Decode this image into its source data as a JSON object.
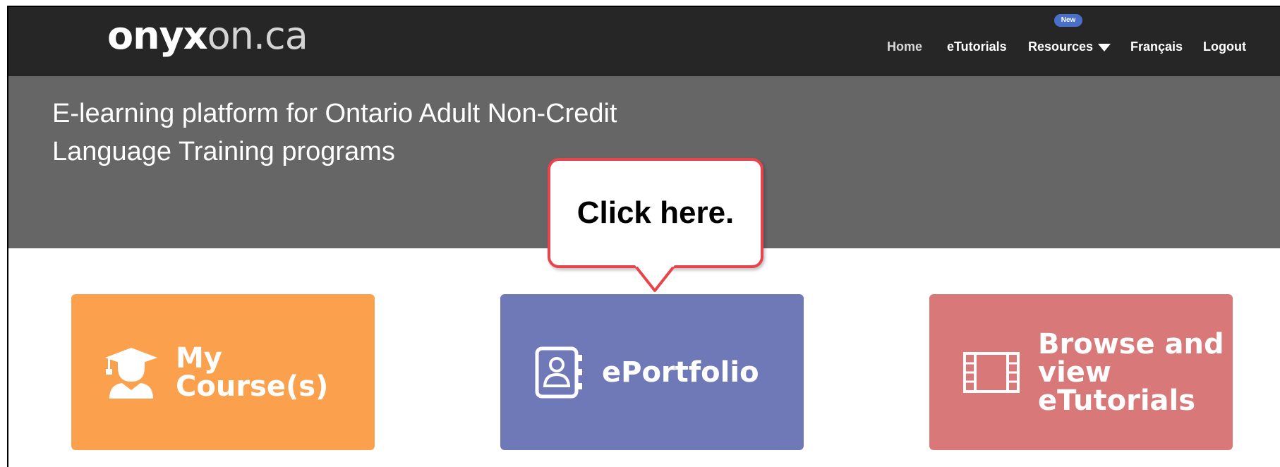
{
  "header": {
    "logo_bold": "onyx",
    "logo_light": "on.ca",
    "nav": {
      "home": "Home",
      "etutorials": "eTutorials",
      "resources": "Resources",
      "resources_badge": "New",
      "francais": "Français",
      "logout": "Logout"
    }
  },
  "hero": {
    "title": "E-learning platform for Ontario Adult Non-Credit Language Training programs"
  },
  "tiles": {
    "courses": {
      "label": "My Course(s)",
      "icon": "graduate-icon",
      "color": "#fba14d"
    },
    "portfolio": {
      "label": "ePortfolio",
      "icon": "contact-book-icon",
      "color": "#7079b8"
    },
    "tutorials": {
      "label": "Browse and\nview eTutorials",
      "icon": "film-strip-icon",
      "color": "#d97879"
    }
  },
  "callout": {
    "text": "Click here.",
    "border_color": "#e9434b"
  }
}
